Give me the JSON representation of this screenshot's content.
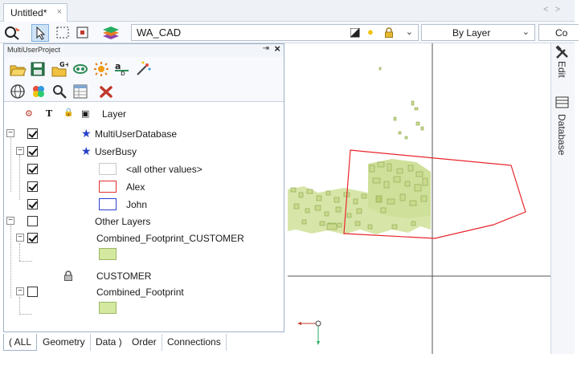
{
  "document_tab": {
    "title": "Untitled*",
    "close": "×"
  },
  "tab_nav": {
    "left": "<",
    "right": ">"
  },
  "toolbar": {
    "layer_name": "WA_CAD",
    "linestyle_value": "By Layer",
    "overflow_value": "Co"
  },
  "panel": {
    "title": "MultiUserProject",
    "pin": "⇥",
    "close": "×",
    "columns": [
      "⚙",
      "T",
      "🔒",
      "▣",
      "Layer"
    ],
    "rows": [
      {
        "label": "MultiUserDatabase",
        "checked": true
      },
      {
        "label": "UserBusy",
        "checked": true
      },
      {
        "label": "<all other values>",
        "checked": true,
        "swatch": "#ffffff",
        "swatch_border": "#c8c8c8"
      },
      {
        "label": "Alex",
        "checked": true,
        "swatch": "#ffffff",
        "swatch_border": "#e03030"
      },
      {
        "label": "John",
        "checked": true,
        "swatch": "#ffffff",
        "swatch_border": "#2d3fd0"
      },
      {
        "label": "Other Layers",
        "checked": false
      },
      {
        "label": "Combined_Footprint_CUSTOMER",
        "checked": true
      },
      {
        "label": "CUSTOMER",
        "locked": true
      },
      {
        "label": "Combined_Footprint",
        "checked": false
      }
    ],
    "fill_color": "#d4e8a0"
  },
  "bottom_tabs": [
    "( ALL",
    "Geometry",
    "Data )",
    "Order",
    "Connections"
  ],
  "right_panel": {
    "edit_label": "Edit",
    "database_label": "Database"
  },
  "colors": {
    "accent": "#2642c8",
    "polygon_outline": "#e8262d",
    "footprint_fill": "#c9da8e",
    "footprint_stroke": "#8aa64a"
  }
}
